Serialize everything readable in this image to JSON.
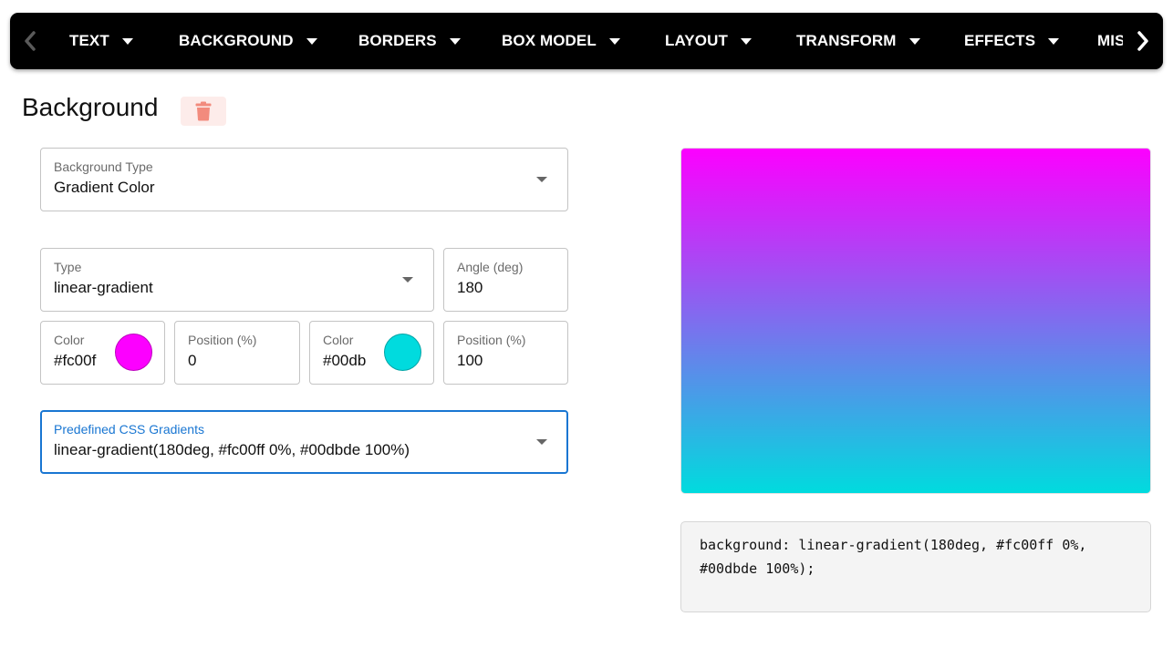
{
  "nav": {
    "items": [
      {
        "label": "TEXT"
      },
      {
        "label": "BACKGROUND"
      },
      {
        "label": "BORDERS"
      },
      {
        "label": "BOX MODEL"
      },
      {
        "label": "LAYOUT"
      },
      {
        "label": "TRANSFORM"
      },
      {
        "label": "EFFECTS"
      },
      {
        "label": "MISC"
      }
    ],
    "left_icon": "chevron-left-icon",
    "right_icon": "chevron-right-icon"
  },
  "section": {
    "title": "Background",
    "delete_icon": "trash-icon"
  },
  "background_type": {
    "label": "Background Type",
    "value": "Gradient Color"
  },
  "gradient_type": {
    "label": "Type",
    "value": "linear-gradient"
  },
  "angle": {
    "label": "Angle (deg)",
    "value": "180"
  },
  "stops": [
    {
      "color_label": "Color",
      "color_value": "#fc00f",
      "swatch_color": "#fc00ff",
      "position_label": "Position (%)",
      "position_value": "0"
    },
    {
      "color_label": "Color",
      "color_value": "#00db",
      "swatch_color": "#00dbde",
      "position_label": "Position (%)",
      "position_value": "100"
    }
  ],
  "predefined": {
    "label": "Predefined CSS Gradients",
    "value": "linear-gradient(180deg, #fc00ff 0%, #00dbde 100%)"
  },
  "preview": {
    "gradient": "linear-gradient(180deg, #fc00ff 0%, #00dbde 100%)"
  },
  "code": {
    "text": "background: linear-gradient(180deg, #fc00ff 0%, #00dbde 100%);"
  },
  "colors": {
    "focus": "#1976d2",
    "delete_bg": "#fdecea",
    "delete_icon": "#f28b7d"
  }
}
